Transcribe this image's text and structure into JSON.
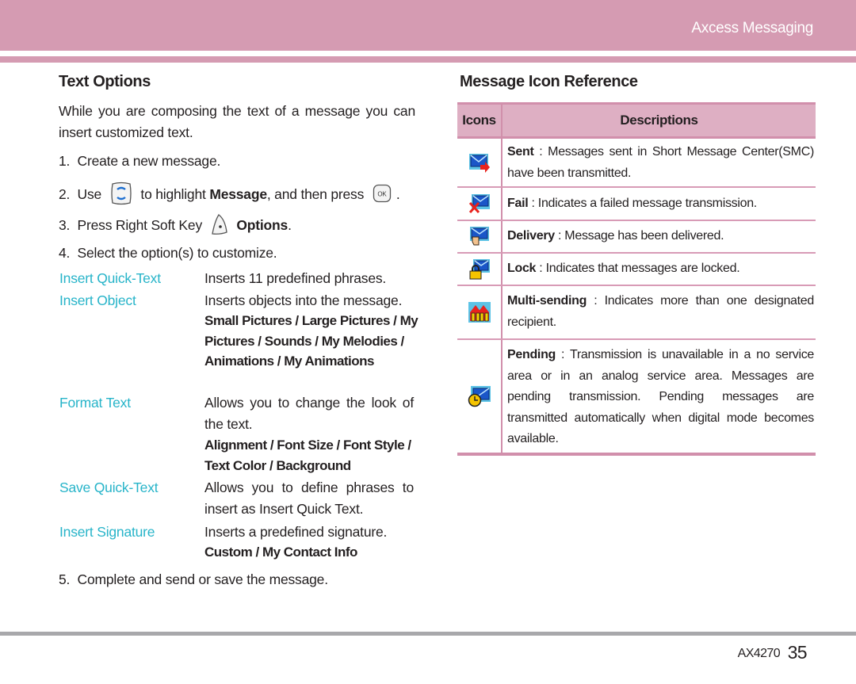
{
  "header": {
    "title": "Axcess Messaging"
  },
  "text_options": {
    "title": "Text Options",
    "intro": "While you are composing the text of a message you can insert customized text.",
    "steps": [
      {
        "num": "1.",
        "text": "Create a new message."
      },
      {
        "num": "2.",
        "pre": "Use",
        "icon": "navigation-key-icon",
        "mid": "to highlight",
        "bold": "Message",
        "post": ", and then press",
        "icon2": "ok-key-icon",
        "end": "."
      },
      {
        "num": "3.",
        "pre": "Press Right Soft Key",
        "icon": "right-soft-key-icon",
        "bold": "Options",
        "end": "."
      },
      {
        "num": "4.",
        "text": "Select the option(s) to customize."
      },
      {
        "num": "5.",
        "text": "Complete and send or save the message."
      }
    ],
    "options": [
      {
        "label": "Insert Quick-Text",
        "desc": "Inserts 11 predefined phrases.",
        "sub": ""
      },
      {
        "label": "Insert Object",
        "desc": "Inserts objects into the message.",
        "sub": "Small Pictures / Large Pictures / My Pictures / Sounds / My Melodies / Animations / My Animations"
      },
      {
        "label": "Format Text",
        "desc": "Allows you to change the look of the text.",
        "sub": "Alignment / Font Size / Font Style / Text Color / Background"
      },
      {
        "label": "Save Quick-Text",
        "desc": "Allows you to define phrases to insert as Insert Quick Text.",
        "sub": ""
      },
      {
        "label": "Insert Signature",
        "desc": "Inserts a predefined signature.",
        "sub": "Custom / My Contact Info"
      }
    ],
    "ok_key_label": "OK"
  },
  "icon_reference": {
    "title": "Message Icon Reference",
    "col_icons": "Icons",
    "col_desc": "Descriptions",
    "rows": [
      {
        "icon": "sent-icon",
        "name": "Sent",
        "text": " : Messages sent in Short Message Center(SMC) have been transmitted."
      },
      {
        "icon": "fail-icon",
        "name": "Fail",
        "text": " : Indicates a failed message transmission."
      },
      {
        "icon": "delivery-icon",
        "name": "Delivery",
        "text": " : Message has been delivered."
      },
      {
        "icon": "lock-icon",
        "name": "Lock",
        "text": " : Indicates that messages are locked."
      },
      {
        "icon": "multi-sending-icon",
        "name": "Multi-sending",
        "text": " : Indicates more than one designated recipient."
      },
      {
        "icon": "pending-icon",
        "name": "Pending",
        "text": " : Transmission is unavailable in a no service area or in an analog service area. Messages are pending transmission. Pending messages are transmitted automatically when digital mode becomes available."
      }
    ]
  },
  "footer": {
    "model": "AX4270",
    "page": "35"
  },
  "colors": {
    "accent_pink": "#d59bb2",
    "option_cyan": "#27b4c9",
    "table_header": "#deafc3",
    "footer_rule": "#a8a8ab"
  }
}
